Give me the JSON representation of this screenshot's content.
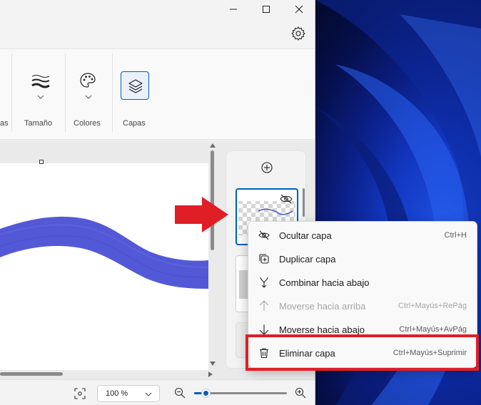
{
  "ribbon": {
    "partial_label": "as",
    "groups": [
      {
        "label": "Tamaño",
        "icon": "brush-size-icon"
      },
      {
        "label": "Colores",
        "icon": "palette-icon"
      },
      {
        "label": "Capas",
        "icon": "layers-icon"
      }
    ]
  },
  "status": {
    "zoom": "100 %",
    "zoom_level": 0.12
  },
  "context_menu": {
    "items": [
      {
        "label": "Ocultar capa",
        "shortcut": "Ctrl+H",
        "icon": "hide-icon",
        "enabled": true
      },
      {
        "label": "Duplicar capa",
        "shortcut": "",
        "icon": "duplicate-icon",
        "enabled": true
      },
      {
        "label": "Combinar hacia abajo",
        "shortcut": "",
        "icon": "merge-down-icon",
        "enabled": true
      },
      {
        "label": "Moverse hacia arriba",
        "shortcut": "Ctrl+Mayús+RePág",
        "icon": "arrow-up-icon",
        "enabled": false
      },
      {
        "label": "Moverse hacia abajo",
        "shortcut": "Ctrl+Mayús+AvPág",
        "icon": "arrow-down-icon",
        "enabled": true
      },
      {
        "label": "Eliminar capa",
        "shortcut": "Ctrl+Mayús+Suprimir",
        "icon": "trash-icon",
        "enabled": true
      }
    ]
  },
  "colors": {
    "accent": "#005fb8",
    "stroke": "#5359d6",
    "highlight": "#e01e26"
  }
}
